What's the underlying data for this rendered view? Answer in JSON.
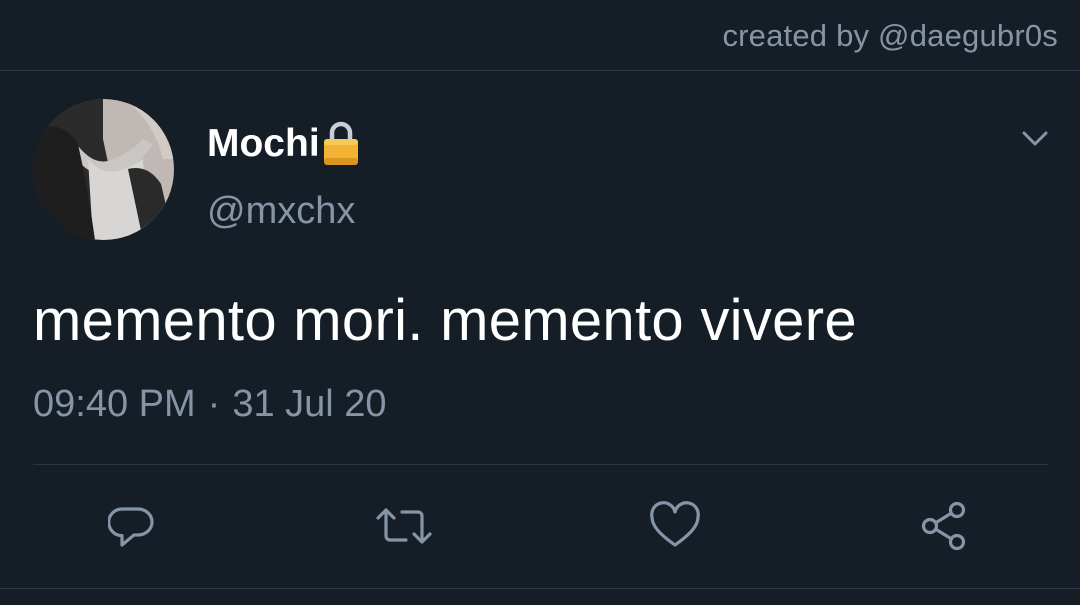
{
  "header": {
    "credit": "created by @daegubr0s"
  },
  "tweet": {
    "display_name": "Mochi",
    "handle": "@mxchx",
    "text": "memento mori. memento vivere",
    "time": "09:40 PM",
    "separator": "·",
    "date": "31 Jul 20"
  },
  "icons": {
    "lock": "lock-icon",
    "menu": "chevron-down-icon",
    "reply": "reply-icon",
    "retweet": "retweet-icon",
    "like": "heart-icon",
    "share": "share-icon"
  },
  "colors": {
    "background": "#151d27",
    "text_primary": "#ffffff",
    "text_secondary": "#8595a6",
    "divider": "#2b3744",
    "lock_gold": "#f2b233"
  }
}
